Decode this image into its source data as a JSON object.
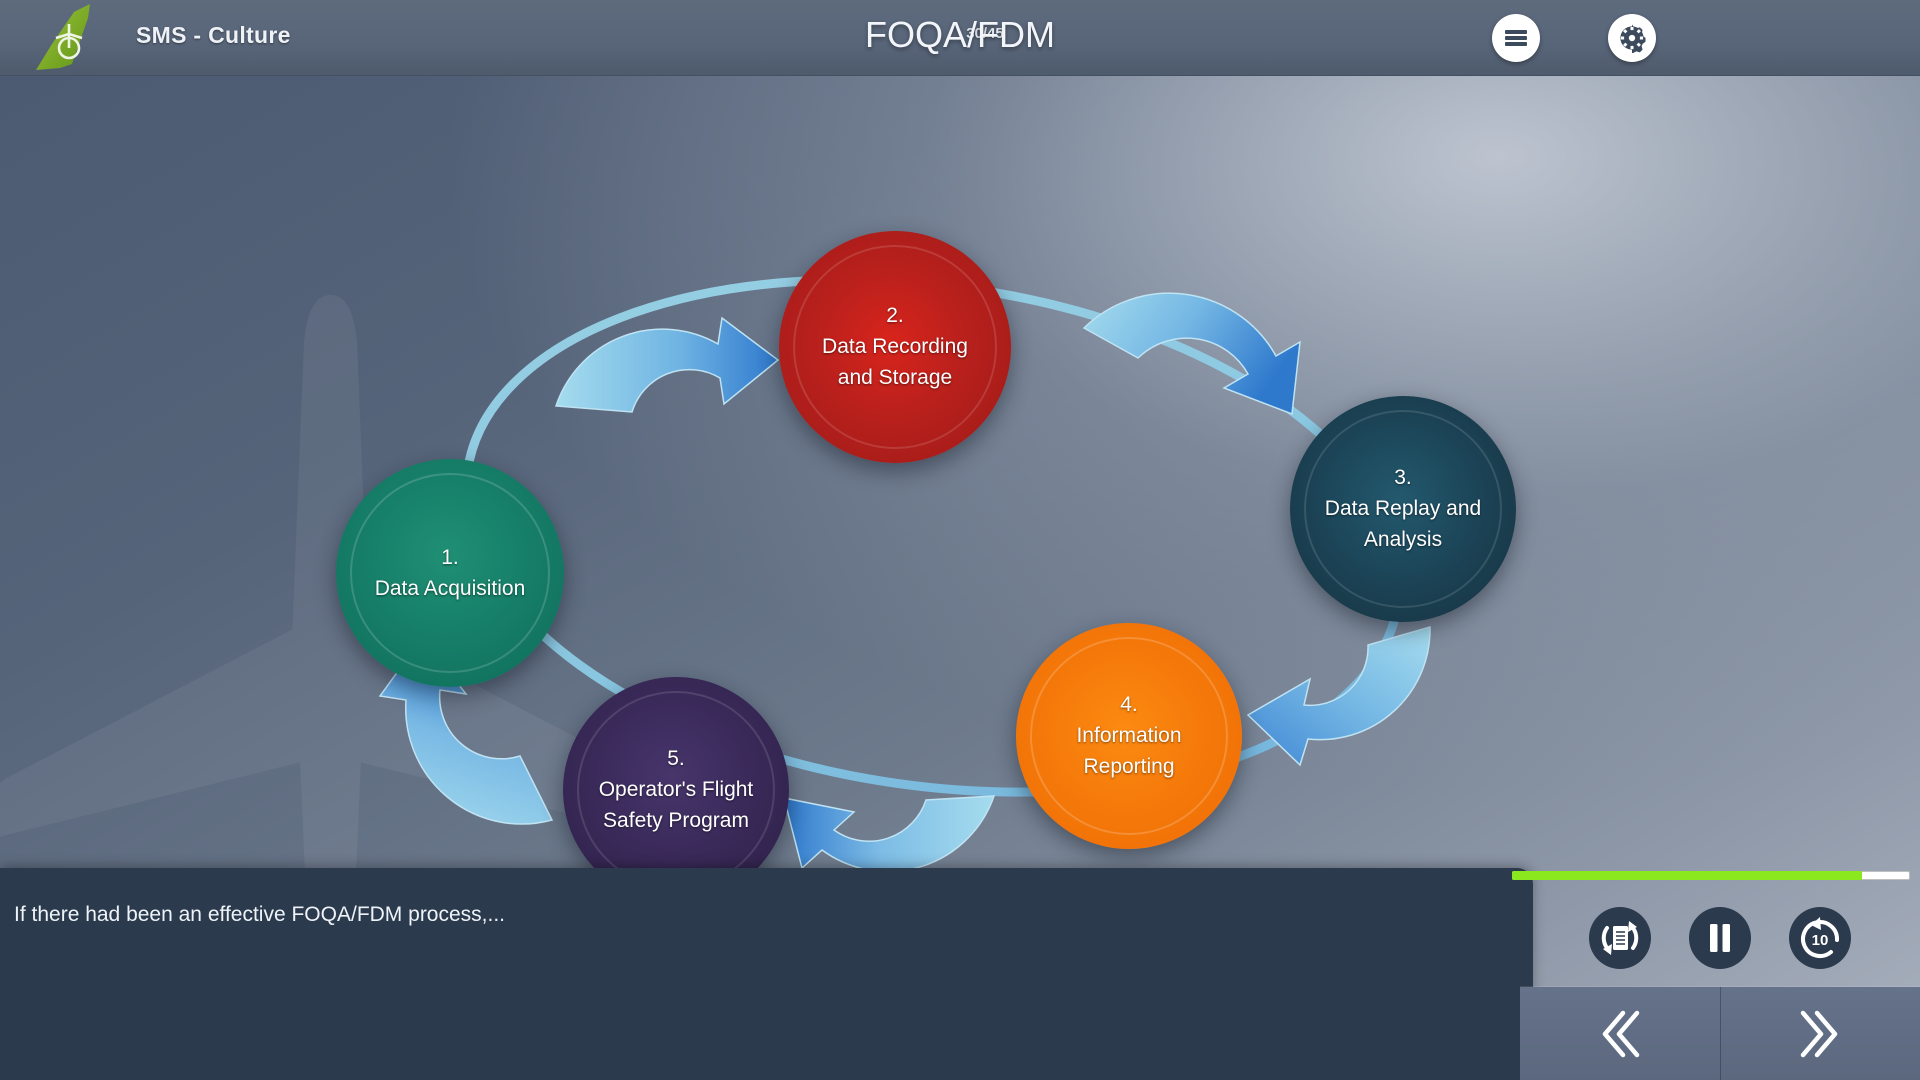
{
  "header": {
    "logo_icon": "airline-tailfin-logo",
    "brand_title": "SMS - Culture",
    "slide_counter": "30/45",
    "deck_title": "FOQA/FDM",
    "menu_icon": "hamburger-menu-icon",
    "settings_icon": "gear-icon"
  },
  "diagram": {
    "type": "cycle",
    "background_watermark": "airplane-silhouette",
    "nodes": [
      {
        "num": "1.",
        "label": "Data Acquisition",
        "color": "#17806a"
      },
      {
        "num": "2.",
        "label": "Data Recording and Storage",
        "color": "#b8201c"
      },
      {
        "num": "3.",
        "label": "Data Replay and Analysis",
        "color": "#1c4558"
      },
      {
        "num": "4.",
        "label": "Information Reporting",
        "color": "#f57a0a"
      },
      {
        "num": "5.",
        "label": "Operator's Flight Safety Program",
        "color": "#3a2a5a"
      }
    ],
    "node_lines": [
      [
        "1.",
        "Data Acquisition"
      ],
      [
        "2.",
        "Data Recording",
        "and Storage"
      ],
      [
        "3.",
        "Data Replay and",
        "Analysis"
      ],
      [
        "4.",
        "Information",
        "Reporting"
      ],
      [
        "5.",
        "Operator's Flight",
        "Safety Program"
      ]
    ],
    "connector_color_start": "#a9ddef",
    "connector_color_end": "#3a7fd0"
  },
  "caption": {
    "text": "If there had been an effective FOQA/FDM process,..."
  },
  "player": {
    "progress_percent": 88,
    "progress_color": "#8ce81e",
    "controls": [
      {
        "name": "replay-document-button",
        "icon": "replay-document-icon"
      },
      {
        "name": "pause-button",
        "icon": "pause-icon"
      },
      {
        "name": "rewind-10-button",
        "icon": "rewind-10-icon",
        "label": "10"
      }
    ],
    "prev_label": "«",
    "next_label": "»"
  }
}
